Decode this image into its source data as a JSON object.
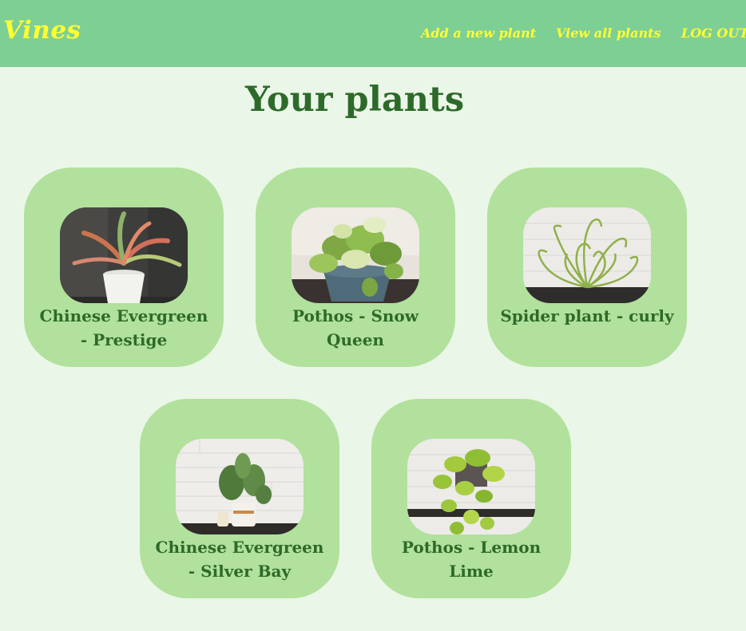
{
  "nav": {
    "brand": "Vines",
    "add_plant": "Add a new plant",
    "view_all": "View all plants",
    "logout": "LOG OUT"
  },
  "main": {
    "title": "Your plants",
    "plants": [
      {
        "name": "Chinese Evergreen - Prestige"
      },
      {
        "name": "Pothos - Snow Queen"
      },
      {
        "name": "Spider plant - curly"
      },
      {
        "name": "Chinese Evergreen - Silver Bay"
      },
      {
        "name": "Pothos - Lemon Lime"
      }
    ]
  },
  "colors": {
    "navbar": "#7ecf94",
    "nav_text": "#ffff33",
    "page_bg": "#eaf6e7",
    "card_bg": "#b1e19c",
    "heading": "#2d6a2a"
  }
}
